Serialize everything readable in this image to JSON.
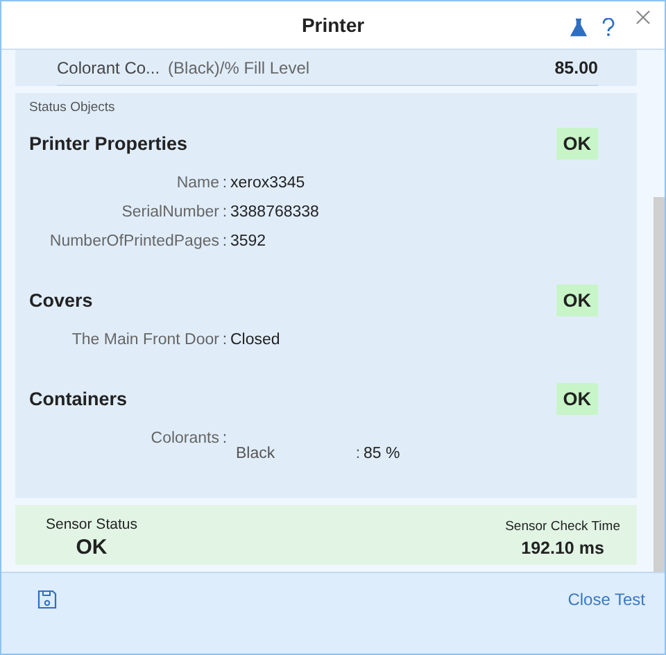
{
  "window": {
    "title": "Printer"
  },
  "top_row": {
    "label": "Colorant Co...",
    "detail": "(Black)/% Fill Level",
    "value": "85.00"
  },
  "status_objects": {
    "heading": "Status Objects",
    "groups": [
      {
        "title": "Printer Properties",
        "status": "OK",
        "fields": [
          {
            "label": "Name",
            "separator": ":",
            "value": "xerox3345"
          },
          {
            "label": "SerialNumber",
            "separator": ":",
            "value": "3388768338"
          },
          {
            "label": "NumberOfPrintedPages",
            "separator": ":",
            "value": "3592"
          }
        ]
      },
      {
        "title": "Covers",
        "status": "OK",
        "fields": [
          {
            "label": "The Main Front Door",
            "separator": ":",
            "value": "Closed"
          }
        ]
      },
      {
        "title": "Containers",
        "status": "OK",
        "fields": [
          {
            "label": "Colorants",
            "separator": ":",
            "children": [
              {
                "label": "Black",
                "separator": ":",
                "value": "85 %"
              }
            ]
          }
        ]
      }
    ]
  },
  "sensor": {
    "status_label": "Sensor Status",
    "status": "OK",
    "time_label": "Sensor Check Time",
    "time": "192.10 ms"
  },
  "footer": {
    "close_label": "Close Test"
  }
}
